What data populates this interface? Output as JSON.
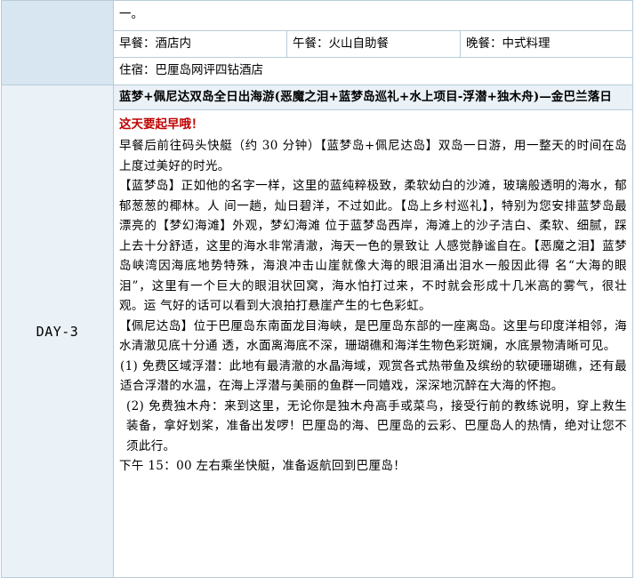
{
  "top_row": {
    "text": "一。"
  },
  "meals": {
    "breakfast": "早餐：酒店内",
    "lunch": "午餐：火山自助餐",
    "dinner": "晚餐：中式料理"
  },
  "hotel": {
    "text": "住宿：巴厘岛网评四钻酒店"
  },
  "day": {
    "label": "DAY-3",
    "title": "蓝梦+佩尼达双岛全日出海游(恶魔之泪+蓝梦岛巡礼+水上项目-浮潜+独木舟)—金巴兰落日",
    "notice": "这天要起早哦！",
    "paragraphs": [
      "早餐后前往码头快艇（约 30 分钟）【蓝梦岛+佩尼达岛】双岛一日游，用一整天的时间在岛上度过美好的时光。",
      "【蓝梦岛】正如他的名字一样，这里的蓝纯粹极致，柔软幼白的沙滩，玻璃般透明的海水，郁郁葱葱的椰林。人 间一趟，灿日碧洋，不过如此。【岛上乡村巡礼】，特别为您安排蓝梦岛最漂亮的【梦幻海滩】外观，梦幻海滩 位于蓝梦岛西岸，海滩上的沙子洁白、柔软、细腻，踩上去十分舒适，这里的海水非常清澈，海天一色的景致让 人感觉静谧自在。【恶魔之泪】蓝梦岛峡湾因海底地势特殊，海浪冲击山崖就像大海的眼泪涌出泪水一般因此得 名“大海的眼泪”，这里有一个巨大的眼泪状回窝，海水怕打过来，不时就会形成十几米高的雾气，很壮观。运 气好的话可以看到大浪拍打悬崖产生的七色彩虹。",
      "【佩尼达岛】位于巴厘岛东南面龙目海峡，是巴厘岛东部的一座离岛。这里与印度洋相邻，海水清澈见底十分通 透，水面离海底不深，珊瑚礁和海洋生物色彩斑斓，水底景物清晰可见。",
      "(1) 免费区域浮潜：此地有最清澈的水晶海域，观赏各式热带鱼及缤纷的软硬珊瑚礁，还有最适合浮潜的水温，在海上浮潜与美丽的鱼群一同嬉戏，深深地沉醉在大海的怀抱。",
      " (2) 免费独木舟：来到这里，无论你是独木舟高手或菜鸟，接受行前的教练说明，穿上救生装备，拿好划桨，准备出发啰！巴厘岛的海、巴厘岛的云彩、巴厘岛人的热情，绝对让您不须此行。",
      "下午 15：00 左右乘坐快艇，准备返航回到巴厘岛！"
    ]
  }
}
